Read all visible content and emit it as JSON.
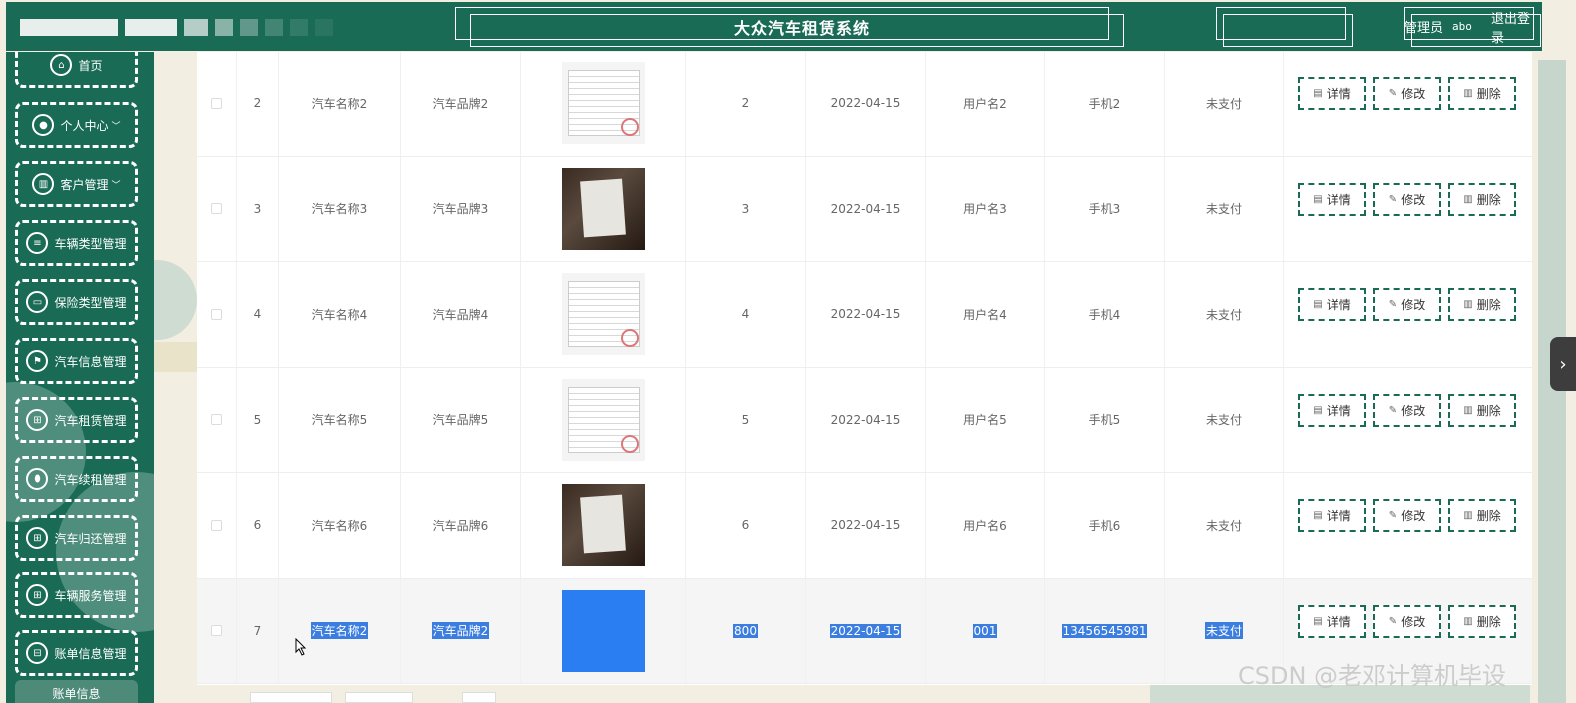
{
  "header": {
    "title": "大众汽车租赁系统",
    "admin_label": "管理员",
    "username": "abo",
    "logout_label": "退出登录"
  },
  "sidebar": {
    "items": [
      {
        "label": "首页",
        "icon": "home-icon",
        "chevron": ""
      },
      {
        "label": "个人中心",
        "icon": "user-icon",
        "chevron": "﹀"
      },
      {
        "label": "客户管理",
        "icon": "library-icon",
        "chevron": "﹀"
      },
      {
        "label": "车辆类型管理",
        "icon": "list-icon",
        "chevron": ""
      },
      {
        "label": "保险类型管理",
        "icon": "monitor-icon",
        "chevron": ""
      },
      {
        "label": "汽车信息管理",
        "icon": "flag-icon",
        "chevron": ""
      },
      {
        "label": "汽车租赁管理",
        "icon": "grid-icon",
        "chevron": ""
      },
      {
        "label": "汽车续租管理",
        "icon": "location-icon",
        "chevron": ""
      },
      {
        "label": "汽车归还管理",
        "icon": "grid-icon",
        "chevron": ""
      },
      {
        "label": "车辆服务管理",
        "icon": "grid-icon",
        "chevron": ""
      },
      {
        "label": "账单信息管理",
        "icon": "lock-icon",
        "chevron": ""
      }
    ],
    "bottom_label": "账单信息"
  },
  "table": {
    "rows": [
      {
        "index": "2",
        "car_name": "汽车名称2",
        "car_brand": "汽车品牌2",
        "image": "paper",
        "amount": "2",
        "date": "2022-04-15",
        "username": "用户名2",
        "phone": "手机2",
        "status": "未支付",
        "selected": false
      },
      {
        "index": "3",
        "car_name": "汽车名称3",
        "car_brand": "汽车品牌3",
        "image": "photo",
        "amount": "3",
        "date": "2022-04-15",
        "username": "用户名3",
        "phone": "手机3",
        "status": "未支付",
        "selected": false
      },
      {
        "index": "4",
        "car_name": "汽车名称4",
        "car_brand": "汽车品牌4",
        "image": "paper",
        "amount": "4",
        "date": "2022-04-15",
        "username": "用户名4",
        "phone": "手机4",
        "status": "未支付",
        "selected": false
      },
      {
        "index": "5",
        "car_name": "汽车名称5",
        "car_brand": "汽车品牌5",
        "image": "paper",
        "amount": "5",
        "date": "2022-04-15",
        "username": "用户名5",
        "phone": "手机5",
        "status": "未支付",
        "selected": false
      },
      {
        "index": "6",
        "car_name": "汽车名称6",
        "car_brand": "汽车品牌6",
        "image": "photo",
        "amount": "6",
        "date": "2022-04-15",
        "username": "用户名6",
        "phone": "手机6",
        "status": "未支付",
        "selected": false
      },
      {
        "index": "7",
        "car_name": "汽车名称2",
        "car_brand": "汽车品牌2",
        "image": "blue",
        "amount": "800",
        "date": "2022-04-15",
        "username": "001",
        "phone": "13456545981",
        "status": "未支付",
        "selected": true
      }
    ],
    "actions": {
      "detail": "详情",
      "edit": "修改",
      "delete": "删除"
    }
  },
  "watermark": "CSDN @老邓计算机毕设",
  "colors": {
    "primary": "#1a6b55",
    "selection": "#3b7ee0",
    "sidebar_border": "#ffffff"
  }
}
